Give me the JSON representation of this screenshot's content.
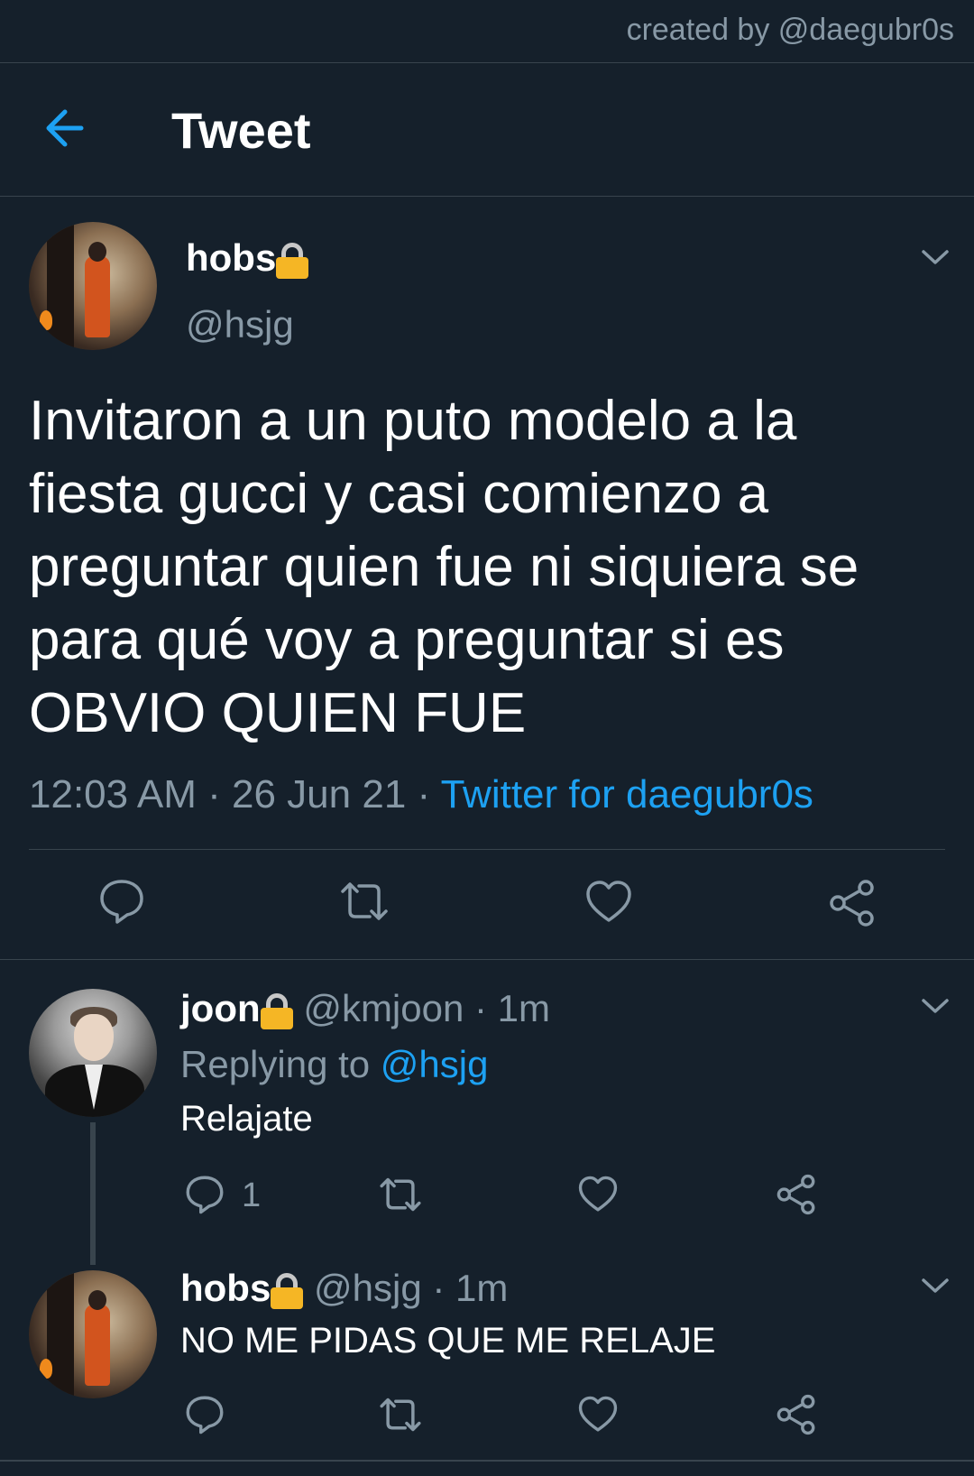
{
  "watermark": "created by @daegubr0s",
  "header": {
    "title": "Tweet",
    "back_icon": "arrow-left-icon"
  },
  "main_tweet": {
    "name": "hobs",
    "handle": "@hsjg",
    "text": "Invitaron a un puto modelo a la fiesta gucci y casi comienzo a preguntar quien fue ni siquiera se para qué voy a preguntar si es OBVIO QUIEN FUE",
    "time": "12:03 AM",
    "sep1": " · ",
    "date": "26 Jun 21",
    "sep2": " · ",
    "client": "Twitter for daegubr0s"
  },
  "replies": [
    {
      "name": "joon",
      "handle": "@kmjoon",
      "sep": " · ",
      "time": "1m",
      "replying_label": "Replying to ",
      "replying_to": "@hsjg",
      "text": "Relajate",
      "reply_count": "1"
    },
    {
      "name": "hobs",
      "handle": "@hsjg",
      "sep": " · ",
      "time": "1m",
      "text": "NO ME PIDAS QUE ME RELAJE"
    }
  ],
  "colors": {
    "background": "#15202b",
    "accent": "#1da1f2",
    "muted": "#8899a6",
    "divider": "#38444d",
    "lock": "#f5b625"
  }
}
